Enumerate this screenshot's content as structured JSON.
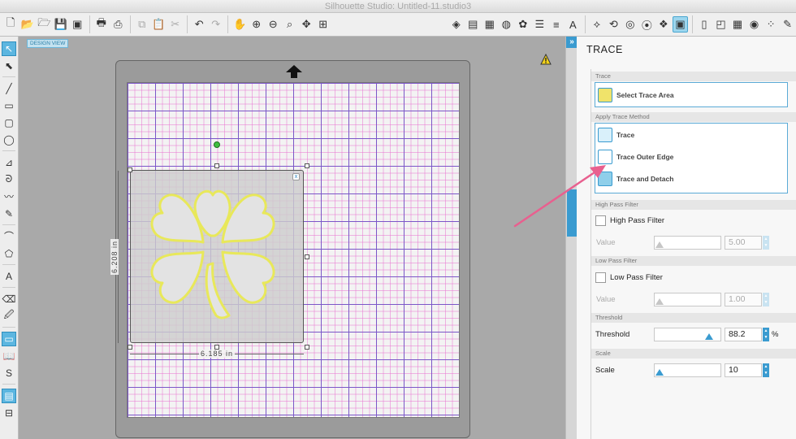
{
  "window": {
    "title": "Silhouette Studio: Untitled-11.studio3"
  },
  "toolbar": {
    "left_icons": [
      "new-document-icon",
      "open-icon",
      "open-recent-icon",
      "save-icon",
      "save-as-icon",
      "print-icon",
      "send-to-silhouette-icon",
      "copy-icon",
      "paste-icon",
      "cut-icon",
      "undo-icon",
      "redo-icon",
      "pan-hand-icon",
      "zoom-in-icon",
      "zoom-out-icon",
      "zoom-selected-icon",
      "move-zoom-icon",
      "fit-to-page-icon"
    ],
    "right_icons": [
      "fill-color-icon",
      "line-color-icon",
      "line-style-icon",
      "gradient-icon",
      "fill-pattern-icon",
      "text-style-icon",
      "line-style-panel-icon",
      "text-icon",
      "transform-icon",
      "replicate-icon",
      "modify-icon",
      "offset-icon",
      "trace-icon",
      "page-setup-icon",
      "grid-icon",
      "registration-marks-icon",
      "cut-settings-icon",
      "send-icon"
    ],
    "active_icon": "trace-icon"
  },
  "canvas": {
    "badge": "DESIGN VIEW",
    "warning_icon": "warning-icon",
    "height_dimension": "6.208 in",
    "width_dimension": "6.185 in",
    "close_glyph": "x"
  },
  "panel": {
    "title": "TRACE",
    "sections": {
      "trace": {
        "header": "Trace",
        "select_area": "Select Trace Area"
      },
      "method": {
        "header": "Apply Trace Method",
        "trace": "Trace",
        "outer": "Trace Outer Edge",
        "detach": "Trace and Detach"
      },
      "high_pass": {
        "header": "High Pass Filter",
        "checkbox": "High Pass Filter",
        "value_label": "Value",
        "value": "5.00",
        "checked": false,
        "level": 0.0
      },
      "low_pass": {
        "header": "Low Pass Filter",
        "checkbox": "Low Pass Filter",
        "value_label": "Value",
        "value": "1.00",
        "checked": false,
        "level": 0.0
      },
      "threshold": {
        "header": "Threshold",
        "label": "Threshold",
        "value": "88.2",
        "unit": "%",
        "level": 0.882
      },
      "scale": {
        "header": "Scale",
        "label": "Scale",
        "value": "10",
        "level": 0.0
      }
    }
  },
  "colors": {
    "accent": "#3a9bd0",
    "trace_outline": "#e8e85a",
    "annotation_arrow": "#e8608f",
    "grid_major": "#7b57c8",
    "grid_minor": "#e878d2"
  }
}
